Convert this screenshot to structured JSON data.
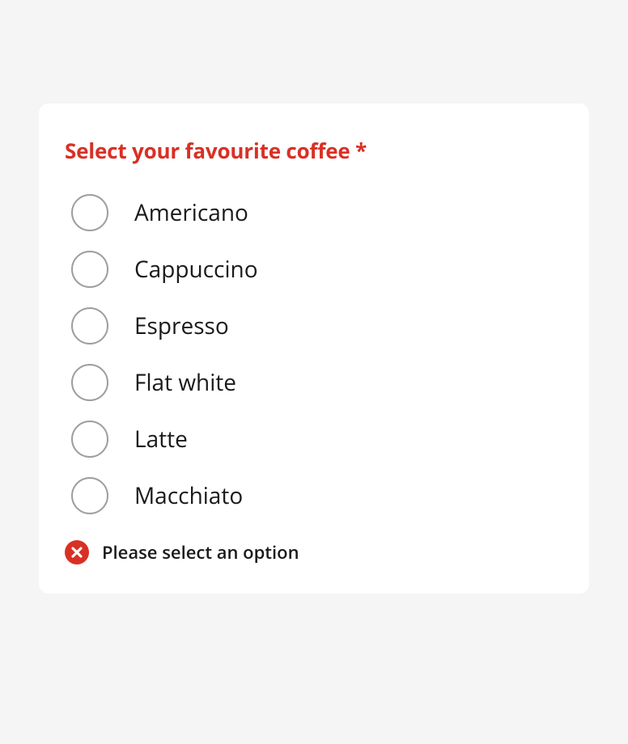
{
  "form": {
    "label": "Select your favourite coffee *",
    "options": [
      {
        "label": "Americano"
      },
      {
        "label": "Cappuccino"
      },
      {
        "label": "Espresso"
      },
      {
        "label": "Flat white"
      },
      {
        "label": "Latte"
      },
      {
        "label": "Macchiato"
      }
    ],
    "error": "Please select an option"
  },
  "colors": {
    "error": "#d93025"
  }
}
